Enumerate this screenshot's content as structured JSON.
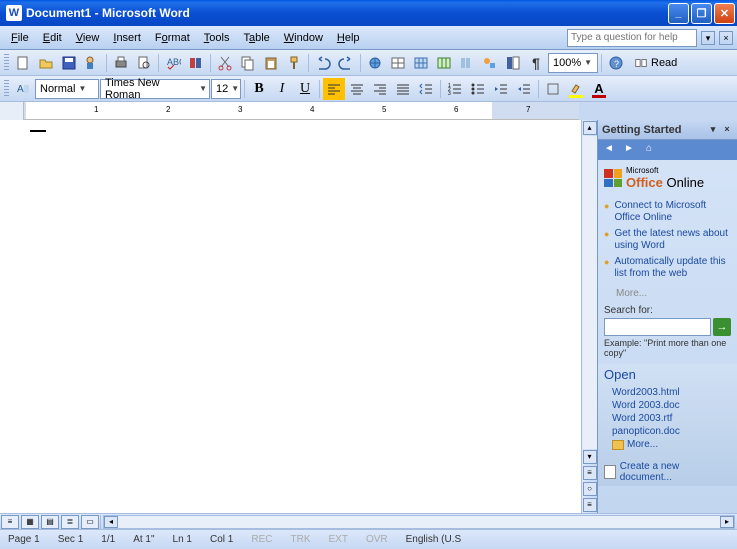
{
  "title": "Document1 - Microsoft Word",
  "menu": [
    "File",
    "Edit",
    "View",
    "Insert",
    "Format",
    "Tools",
    "Table",
    "Window",
    "Help"
  ],
  "help_placeholder": "Type a question for help",
  "zoom": "100%",
  "read_label": "Read",
  "style": "Normal",
  "font": "Times New Roman",
  "size": "12",
  "ruler_marks": [
    "1",
    "2",
    "3",
    "4",
    "5",
    "6",
    "7"
  ],
  "taskpane": {
    "title": "Getting Started",
    "office_label_a": "Microsoft",
    "office_label_b": "Office",
    "office_label_c": "Online",
    "links": [
      "Connect to Microsoft Office Online",
      "Get the latest news about using Word",
      "Automatically update this list from the web"
    ],
    "more": "More...",
    "search_label": "Search for:",
    "example": "Example: \"Print more than one copy\"",
    "open_title": "Open",
    "files": [
      "Word2003.html",
      "Word 2003.doc",
      "Word 2003.rtf",
      "panopticon.doc"
    ],
    "files_more": "More...",
    "create": "Create a new document..."
  },
  "status": {
    "page": "Page  1",
    "sec": "Sec  1",
    "pages": "1/1",
    "at": "At  1\"",
    "ln": "Ln  1",
    "col": "Col  1",
    "rec": "REC",
    "trk": "TRK",
    "ext": "EXT",
    "ovr": "OVR",
    "lang": "English (U.S"
  }
}
